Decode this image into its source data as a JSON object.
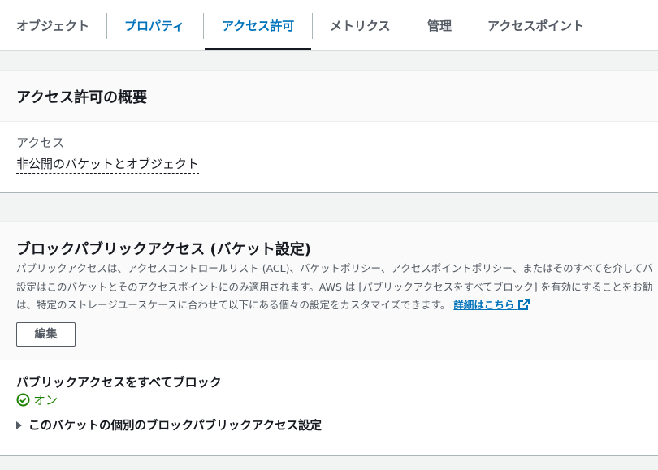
{
  "tabs": [
    {
      "label": "オブジェクト"
    },
    {
      "label": "プロパティ"
    },
    {
      "label": "アクセス許可"
    },
    {
      "label": "メトリクス"
    },
    {
      "label": "管理"
    },
    {
      "label": "アクセスポイント"
    }
  ],
  "overview": {
    "title": "アクセス許可の概要",
    "access_label": "アクセス",
    "access_value": "非公開のバケットとオブジェクト"
  },
  "block_public": {
    "title": "ブロックパブリックアクセス (バケット設定)",
    "desc_line1": "パブリックアクセスは、アクセスコントロールリスト (ACL)、バケットポリシー、アクセスポイントポリシー、またはそのすべてを介してバ",
    "desc_line2": "設定はこのバケットとそのアクセスポイントにのみ適用されます。AWS は [パブリックアクセスをすべてブロック] を有効にすることをお勧",
    "desc_line3": "は、特定のストレージユースケースに合わせて以下にある個々の設定をカスタマイズできます。",
    "learn_more": "詳細はこちら",
    "edit_button": "編集",
    "block_all_label": "パブリックアクセスをすべてブロック",
    "block_all_status": "オン",
    "individual_label": "このバケットの個別のブロックパブリックアクセス設定"
  },
  "colors": {
    "accent": "#0073bb",
    "success": "#1d8102"
  },
  "icons": [
    "check-circle-icon",
    "external-link-icon",
    "caret-right-icon"
  ]
}
